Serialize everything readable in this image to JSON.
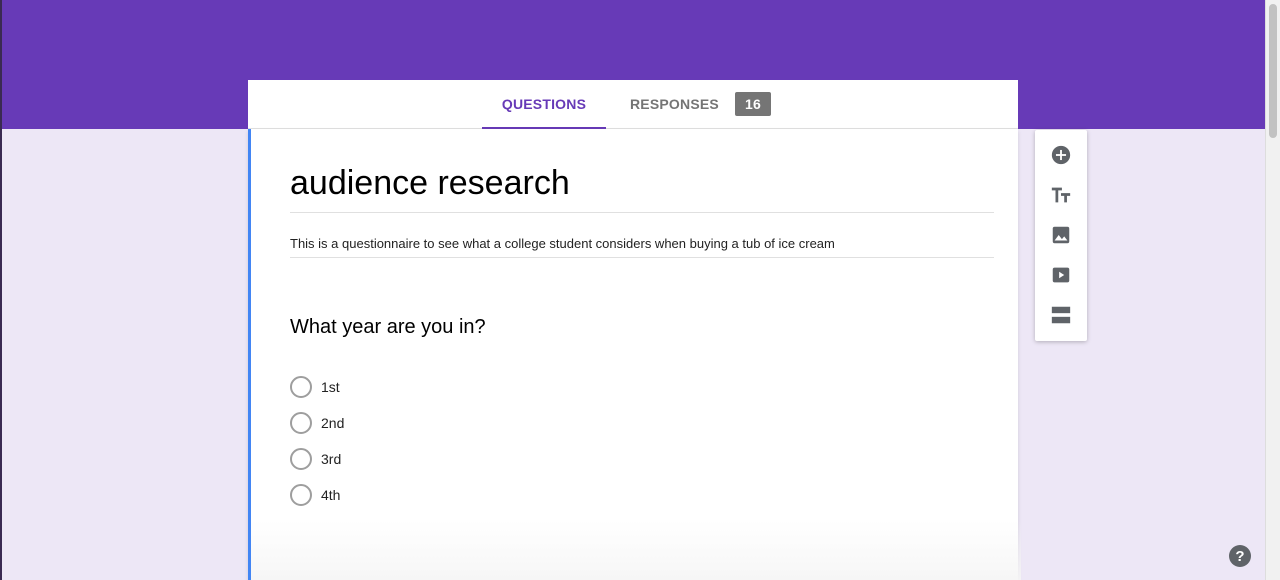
{
  "tabs": {
    "questions_label": "QUESTIONS",
    "responses_label": "RESPONSES",
    "responses_count": "16"
  },
  "form": {
    "title": "audience research",
    "description": "This is a questionnaire to see what a college student considers when buying a tub of ice cream"
  },
  "question": {
    "title": "What year are you in?",
    "options": [
      "1st",
      "2nd",
      "3rd",
      "4th"
    ]
  },
  "toolbar": {
    "icons": [
      "add-circle-icon",
      "title-text-icon",
      "image-icon",
      "video-icon",
      "section-icon"
    ]
  },
  "help": {
    "label": "?"
  },
  "colors": {
    "theme": "#673ab7",
    "background": "#ede7f6",
    "active_card_border": "#4285f4"
  }
}
